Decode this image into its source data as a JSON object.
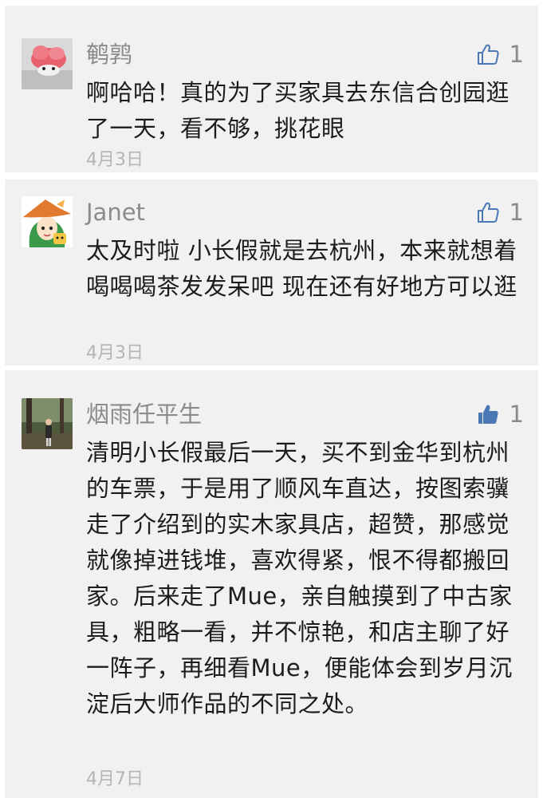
{
  "comments": [
    {
      "author": "鹌鹑",
      "avatar_icon": "pink-fluffy-animal-avatar",
      "like_icon": "thumbs-up-outline-icon",
      "like_count": "1",
      "text": "啊哈哈！真的为了买家具去东信合创园逛了一天，看不够，挑花眼",
      "date": "4月3日"
    },
    {
      "author": "Janet",
      "avatar_icon": "cartoon-girl-witch-hat-avatar",
      "like_icon": "thumbs-up-outline-icon",
      "like_count": "1",
      "text": "太及时啦 小长假就是去杭州，本来就想着喝喝喝茶发发呆吧 现在还有好地方可以逛",
      "date": "4月3日"
    },
    {
      "author": "烟雨任平生",
      "avatar_icon": "person-in-forest-photo-avatar",
      "like_icon": "thumbs-up-filled-icon",
      "like_count": "1",
      "text": "清明小长假最后一天，买不到金华到杭州的车票，于是用了顺风车直达，按图索骥走了介绍到的实木家具店，超赞，那感觉就像掉进钱堆，喜欢得紧，恨不得都搬回家。后来走了Mue，亲自触摸到了中古家具，粗略一看，并不惊艳，和店主聊了好一阵子，再细看Mue，便能体会到岁月沉淀后大师作品的不同之处。",
      "date": "4月7日"
    }
  ],
  "colors": {
    "card_bg": "#f1f1f1",
    "name": "#8b8b8b",
    "text": "#1c1c1c",
    "date": "#b4b4b4",
    "like_outline": "#4a78b5",
    "like_filled": "#4a78b5"
  }
}
